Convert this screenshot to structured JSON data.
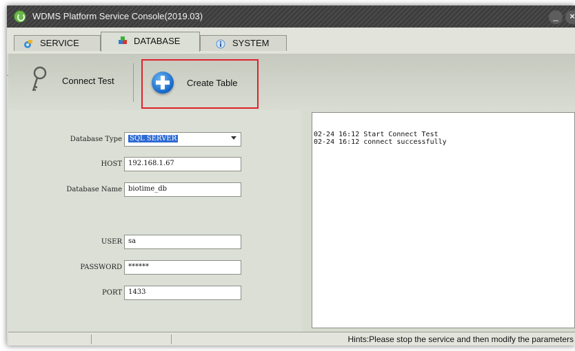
{
  "window": {
    "title": "WDMS Platform Service Console(2019.03)",
    "minimize_label": "_",
    "close_label": "×"
  },
  "tabs": [
    {
      "label": "SERVICE",
      "icon": "service-gear-icon",
      "active": false
    },
    {
      "label": "DATABASE",
      "icon": "database-icon",
      "active": true
    },
    {
      "label": "SYSTEM",
      "icon": "info-icon",
      "active": false
    }
  ],
  "toolbar": {
    "connect_test": "Connect Test",
    "create_table": "Create Table"
  },
  "form": {
    "database_type": {
      "label": "Database Type",
      "value": "SQL SERVER"
    },
    "host": {
      "label": "HOST",
      "value": "192.168.1.67"
    },
    "database_name": {
      "label": "Database Name",
      "value": "biotime_db"
    },
    "user": {
      "label": "USER",
      "value": "sa"
    },
    "password": {
      "label": "PASSWORD",
      "value": "******"
    },
    "port": {
      "label": "PORT",
      "value": "1433"
    }
  },
  "log": [
    "02-24 16:12 Start Connect Test",
    "02-24 16:12 connect successfully"
  ],
  "status": {
    "hints": "Hints:Please stop the service and then modify the parameters"
  },
  "colors": {
    "highlight_border": "#e0202a",
    "selection": "#2c6ad4",
    "titlebar": "#444444"
  }
}
